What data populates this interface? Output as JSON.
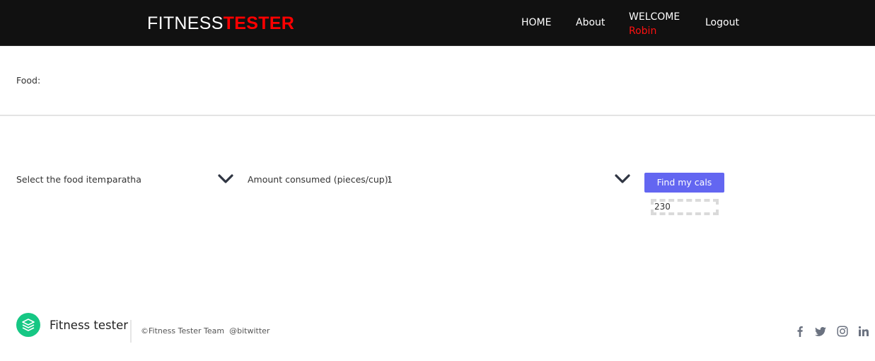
{
  "header": {
    "logo_part1": "FITNESS",
    "logo_part2": "TESTER",
    "nav": {
      "home": "HOME",
      "about": "About",
      "welcome": "WELCOME",
      "user": "Robin",
      "logout": "Logout"
    }
  },
  "main": {
    "food_label": "Food:",
    "food_item_label": "Select the food item:",
    "food_item_value": "paratha",
    "amount_label": "Amount consumed (pieces/cup):",
    "amount_value": "1",
    "find_button": "Find my cals",
    "result": "230"
  },
  "footer": {
    "name": "Fitness tester",
    "copyright": "©Fitness Tester Team",
    "handle": "@bitwitter",
    "social_icons": [
      "facebook-icon",
      "twitter-icon",
      "instagram-icon",
      "linkedin-icon"
    ]
  },
  "colors": {
    "header_bg": "#111111",
    "brand_red": "#ff0000",
    "button": "#6366f1",
    "footer_logo": "#16c784"
  }
}
